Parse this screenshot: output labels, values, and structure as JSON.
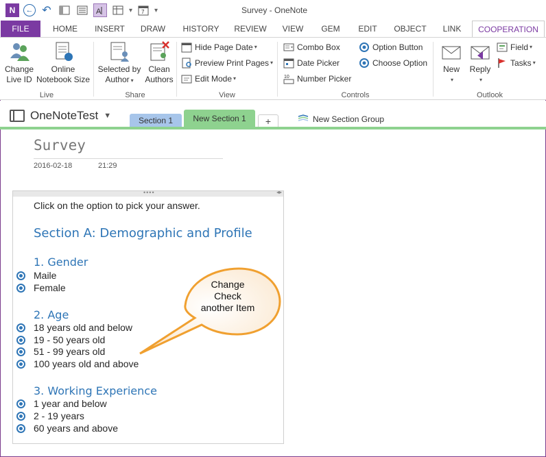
{
  "window": {
    "title": "Survey - OneNote"
  },
  "qat": {
    "logo": "N",
    "undo_glyph": "↶",
    "back_glyph": "←"
  },
  "tabs": [
    {
      "label": "FILE"
    },
    {
      "label": "HOME"
    },
    {
      "label": "INSERT"
    },
    {
      "label": "DRAW"
    },
    {
      "label": "HISTORY"
    },
    {
      "label": "REVIEW"
    },
    {
      "label": "VIEW"
    },
    {
      "label": "GEM"
    },
    {
      "label": "EDIT"
    },
    {
      "label": "OBJECT"
    },
    {
      "label": "LINK"
    },
    {
      "label": "COOPERATION"
    }
  ],
  "ribbon": {
    "live": {
      "label": "Live",
      "change_live_id": "Change\nLive ID",
      "online_nb": "Online\nNotebook Size"
    },
    "share": {
      "label": "Share",
      "selected_by": "Selected by",
      "author": "Author",
      "clean": "Clean",
      "authors": "Authors"
    },
    "view": {
      "label": "View",
      "hide_page_date": "Hide Page Date",
      "preview_print": "Preview Print Pages",
      "edit_mode": "Edit Mode"
    },
    "controls": {
      "label": "Controls",
      "combo_box": "Combo Box",
      "date_picker": "Date Picker",
      "number_picker": "Number Picker",
      "option_button": "Option Button",
      "choose_option": "Choose Option"
    },
    "outlook": {
      "label": "Outlook",
      "new": "New",
      "reply": "Reply",
      "field": "Field",
      "tasks": "Tasks"
    }
  },
  "notebook": {
    "name": "OneNoteTest",
    "sections": [
      {
        "label": "Section 1"
      },
      {
        "label": "New Section 1"
      }
    ],
    "add_label": "+",
    "new_section_group": "New Section Group"
  },
  "page": {
    "title": "Survey",
    "date": "2016-02-18",
    "time": "21:29",
    "instruction": "Click on the option to pick your answer.",
    "section_heading": "Section A: Demographic and Profile",
    "q1": {
      "heading": "1. Gender",
      "options": [
        "Maile",
        "Female"
      ]
    },
    "q2": {
      "heading": "2. Age",
      "options": [
        "18 years old and below",
        "19 - 50 years old",
        "51 - 99 years old",
        "100 years old and above"
      ]
    },
    "q3": {
      "heading": "3. Working Experience",
      "options": [
        "1 year and below",
        "2 - 19 years",
        "60 years and above"
      ]
    }
  },
  "callout": {
    "line1": "Change",
    "line2": "Check",
    "line3": "another Item"
  },
  "colors": {
    "accent": "#7b3aa2",
    "heading": "#2e75b6",
    "section1": "#a7c5ea",
    "section2": "#8ed28f",
    "callout_border": "#f0a030"
  }
}
